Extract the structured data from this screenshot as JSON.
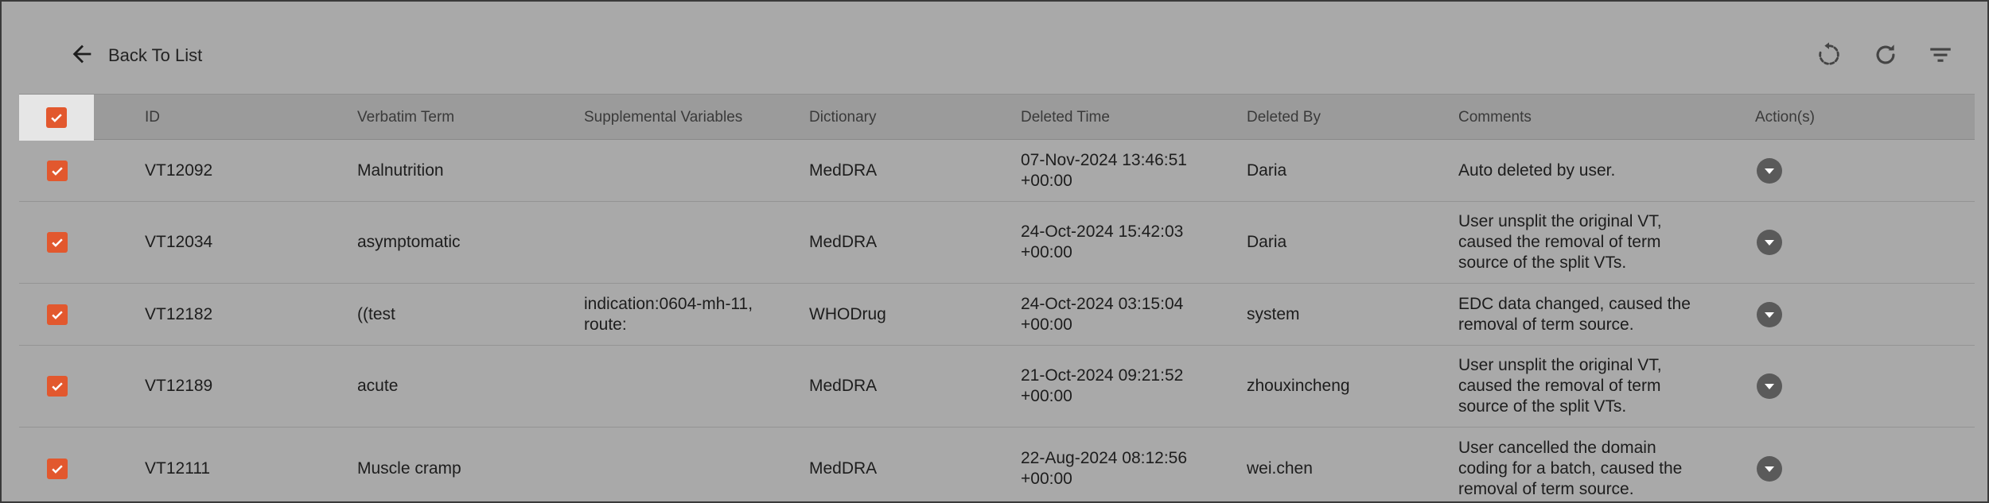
{
  "header": {
    "back_label": "Back To List",
    "tools": [
      "undo-icon",
      "refresh-icon",
      "filter-icon"
    ]
  },
  "table": {
    "columns": [
      "ID",
      "Verbatim Term",
      "Supplemental Variables",
      "Dictionary",
      "Deleted Time",
      "Deleted By",
      "Comments",
      "Action(s)"
    ],
    "rows": [
      {
        "id": "VT12092",
        "verbatim": "Malnutrition",
        "supplemental": "",
        "dictionary": "MedDRA",
        "deleted_time": "07-Nov-2024 13:46:51\n+00:00",
        "deleted_by": "Daria",
        "comments": "Auto deleted by user.",
        "checked": true
      },
      {
        "id": "VT12034",
        "verbatim": "asymptomatic",
        "supplemental": "",
        "dictionary": "MedDRA",
        "deleted_time": "24-Oct-2024 15:42:03\n+00:00",
        "deleted_by": "Daria",
        "comments": "User unsplit the original VT,\ncaused the removal of term\nsource of the split VTs.",
        "checked": true
      },
      {
        "id": "VT12182",
        "verbatim": "((test",
        "supplemental": "indication:0604-mh-11,\nroute:",
        "dictionary": "WHODrug",
        "deleted_time": "24-Oct-2024 03:15:04\n+00:00",
        "deleted_by": "system",
        "comments": "EDC data changed, caused the\nremoval of term source.",
        "checked": true
      },
      {
        "id": "VT12189",
        "verbatim": "acute",
        "supplemental": "",
        "dictionary": "MedDRA",
        "deleted_time": "21-Oct-2024 09:21:52\n+00:00",
        "deleted_by": "zhouxincheng",
        "comments": "User unsplit the original VT,\ncaused the removal of term\nsource of the split VTs.",
        "checked": true
      },
      {
        "id": "VT12111",
        "verbatim": "Muscle cramp",
        "supplemental": "",
        "dictionary": "MedDRA",
        "deleted_time": "22-Aug-2024 08:12:56\n+00:00",
        "deleted_by": "wei.chen",
        "comments": "User cancelled the domain\ncoding for a batch, caused the\nremoval of term source.",
        "checked": true
      }
    ]
  },
  "colors": {
    "accent": "#e2582e",
    "background": "#a9a9a9",
    "header_row": "#9b9b9b",
    "action_button": "#5a5a5a"
  }
}
